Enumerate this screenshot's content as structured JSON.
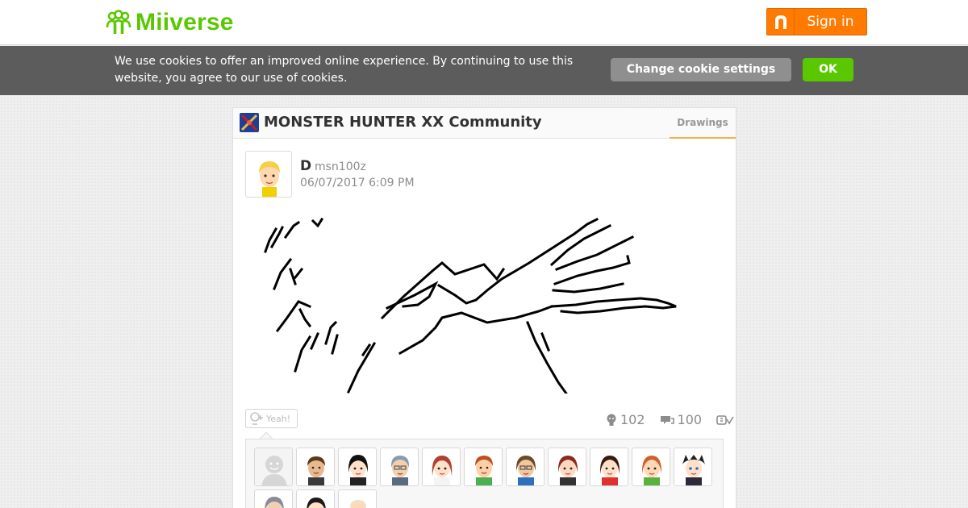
{
  "header": {
    "logo_text": "Miiverse",
    "signin_label": "Sign in"
  },
  "cookie": {
    "message": "We use cookies to offer an improved online experience. By continuing to use this website, you agree to our use of cookies.",
    "change_label": "Change cookie settings",
    "ok_label": "OK"
  },
  "community": {
    "title": "MONSTER HUNTER XX Community",
    "tab": "Drawings"
  },
  "post": {
    "author_name": "D",
    "author_id": "msn100z",
    "timestamp": "06/07/2017 6:09 PM",
    "yeah_label": "Yeah!",
    "yeah_count": "102",
    "comment_count": "100"
  },
  "colors": {
    "brand_green": "#5ac800",
    "signin_orange": "#ff7a00",
    "tab_accent": "#f3b14b",
    "cookie_bar": "#5c5c5c"
  },
  "icons": [
    "miiverse-logo-icon",
    "nintendo-network-icon",
    "game-icon",
    "yeah-icon",
    "comment-icon",
    "spoiler-icon"
  ]
}
